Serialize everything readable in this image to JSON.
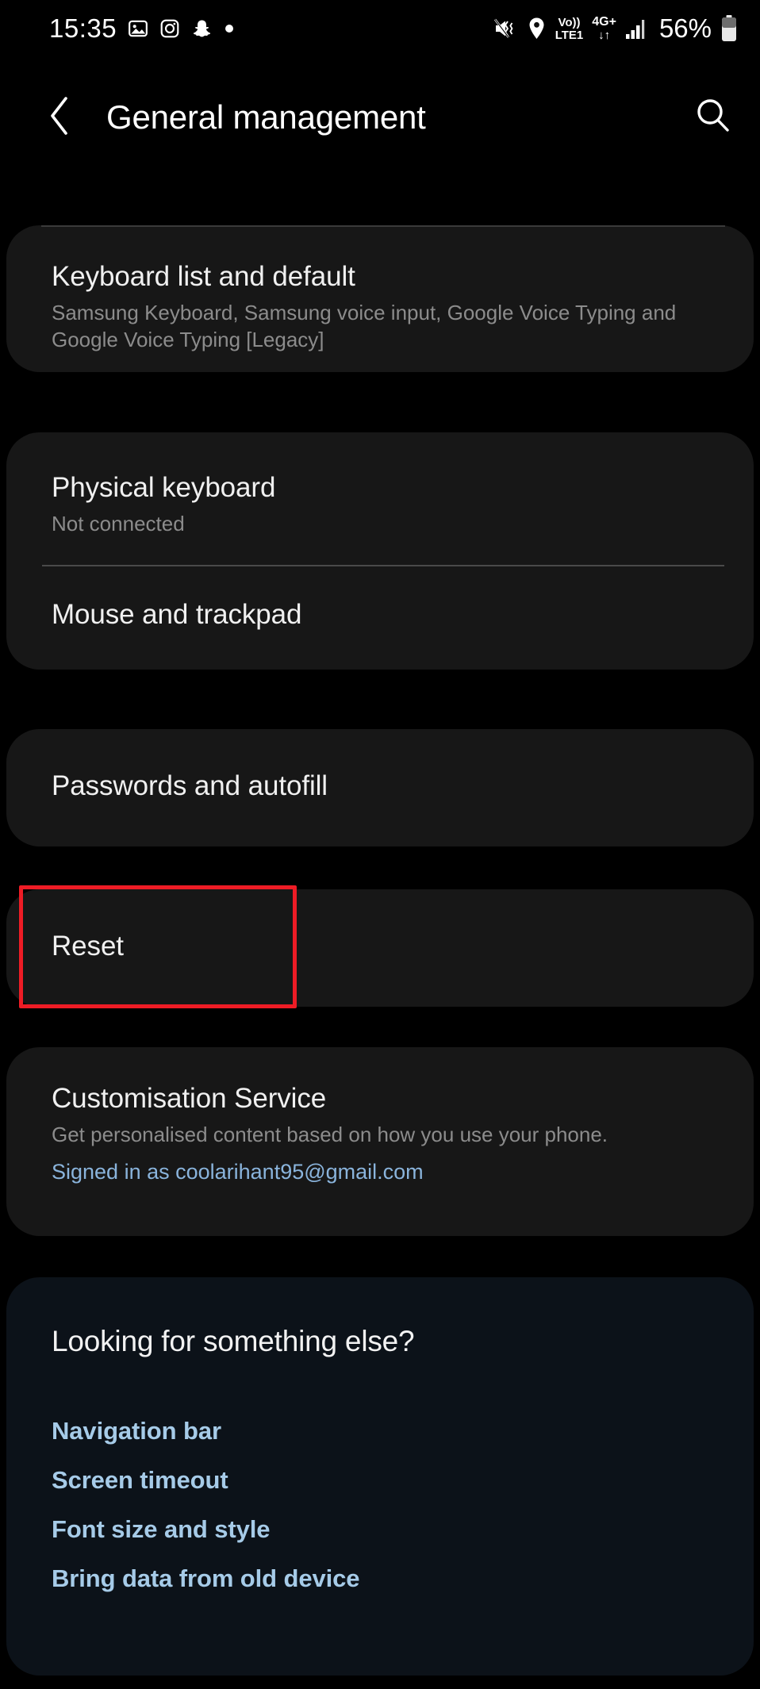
{
  "status_bar": {
    "time": "15:35",
    "left_icons": [
      "photos-icon",
      "instagram-icon",
      "snapchat-icon",
      "dot-icon"
    ],
    "right_icons": [
      "mute-vibrate-icon",
      "location-icon",
      "volte-icon",
      "4g-plus-icon",
      "signal-bars-icon"
    ],
    "volte_line1": "Vo))",
    "volte_line2": "LTE1",
    "network_type": "4G+",
    "network_arrows": "↓↑",
    "battery_percent": "56%"
  },
  "header": {
    "back_icon": "chevron-left-icon",
    "title": "General management",
    "search_icon": "search-icon"
  },
  "cards": [
    {
      "id": "keyboard-card",
      "rows": [
        {
          "name": "keyboard-list-and-default",
          "title": "Keyboard list and default",
          "subtitle": "Samsung Keyboard, Samsung voice input, Google Voice Typing and Google Voice Typing [Legacy]"
        }
      ]
    },
    {
      "id": "input-devices-card",
      "rows": [
        {
          "name": "physical-keyboard",
          "title": "Physical keyboard",
          "subtitle": "Not connected"
        },
        {
          "name": "mouse-and-trackpad",
          "title": "Mouse and trackpad",
          "subtitle": ""
        }
      ]
    },
    {
      "id": "passwords-card",
      "rows": [
        {
          "name": "passwords-and-autofill",
          "title": "Passwords and autofill",
          "subtitle": ""
        }
      ]
    },
    {
      "id": "reset-card",
      "rows": [
        {
          "name": "reset",
          "title": "Reset",
          "subtitle": ""
        }
      ]
    },
    {
      "id": "customisation-card",
      "rows": [
        {
          "name": "customisation-service",
          "title": "Customisation Service",
          "subtitle": "Get personalised content based on how you use your phone.",
          "link": "Signed in as coolarihant95@gmail.com"
        }
      ]
    }
  ],
  "looking_for": {
    "heading": "Looking for something else?",
    "links": [
      "Navigation bar",
      "Screen timeout",
      "Font size and style",
      "Bring data from old device"
    ]
  },
  "annotation": {
    "highlight_target": "reset",
    "highlight_color": "#ee1c25"
  },
  "colors": {
    "background": "#000000",
    "card": "#171717",
    "card_blue": "#0c1219",
    "title_text": "#f0f0f0",
    "subtitle_text": "#8c8c8c",
    "link_text": "#8ab4dc",
    "quick_link_text": "#a6cbe8"
  }
}
